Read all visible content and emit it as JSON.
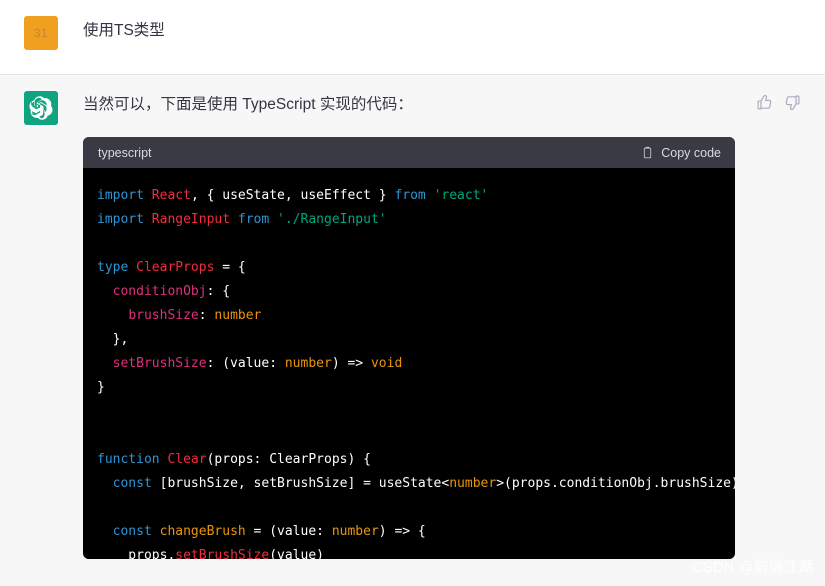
{
  "user_turn": {
    "avatar_label": "31",
    "avatar_color": "#f0a020",
    "message": "使用TS类型"
  },
  "assistant_turn": {
    "avatar_color": "#10a37f",
    "avatar_icon": "openai-logo-icon",
    "message": "当然可以，下面是使用 TypeScript 实现的代码：",
    "feedback": {
      "thumbs_up_icon": "thumbs-up-icon",
      "thumbs_down_icon": "thumbs-down-icon"
    },
    "code_block": {
      "language_label": "typescript",
      "copy_label": "Copy code",
      "copy_icon": "clipboard-icon",
      "header_bg": "#3a3a45",
      "body_bg": "#000000",
      "lines": [
        [
          {
            "t": "import ",
            "c": "t-kw"
          },
          {
            "t": "React",
            "c": "t-cls"
          },
          {
            "t": ", { useState, useEffect } ",
            "c": "t-plain"
          },
          {
            "t": "from ",
            "c": "t-kw"
          },
          {
            "t": "'react'",
            "c": "t-str"
          }
        ],
        [
          {
            "t": "import ",
            "c": "t-kw"
          },
          {
            "t": "RangeInput ",
            "c": "t-cls"
          },
          {
            "t": "from ",
            "c": "t-kw"
          },
          {
            "t": "'./RangeInput'",
            "c": "t-str"
          }
        ],
        [],
        [
          {
            "t": "type ",
            "c": "t-kw"
          },
          {
            "t": "ClearProps ",
            "c": "t-cls"
          },
          {
            "t": "= {",
            "c": "t-plain"
          }
        ],
        [
          {
            "t": "  ",
            "c": "t-plain"
          },
          {
            "t": "conditionObj",
            "c": "t-prop"
          },
          {
            "t": ": {",
            "c": "t-plain"
          }
        ],
        [
          {
            "t": "    ",
            "c": "t-plain"
          },
          {
            "t": "brushSize",
            "c": "t-prop"
          },
          {
            "t": ": ",
            "c": "t-plain"
          },
          {
            "t": "number",
            "c": "t-type"
          }
        ],
        [
          {
            "t": "  },",
            "c": "t-plain"
          }
        ],
        [
          {
            "t": "  ",
            "c": "t-plain"
          },
          {
            "t": "setBrushSize",
            "c": "t-prop"
          },
          {
            "t": ": (value: ",
            "c": "t-plain"
          },
          {
            "t": "number",
            "c": "t-type"
          },
          {
            "t": ") => ",
            "c": "t-plain"
          },
          {
            "t": "void",
            "c": "t-type"
          }
        ],
        [
          {
            "t": "}",
            "c": "t-plain"
          }
        ],
        [],
        [],
        [
          {
            "t": "function ",
            "c": "t-kw"
          },
          {
            "t": "Clear",
            "c": "t-cls"
          },
          {
            "t": "(props: ClearProps) {",
            "c": "t-plain"
          }
        ],
        [
          {
            "t": "  ",
            "c": "t-plain"
          },
          {
            "t": "const ",
            "c": "t-kw"
          },
          {
            "t": "[brushSize, setBrushSize] = useState<",
            "c": "t-plain"
          },
          {
            "t": "number",
            "c": "t-type"
          },
          {
            "t": ">(props.conditionObj.brushSize)",
            "c": "t-plain"
          }
        ],
        [],
        [
          {
            "t": "  ",
            "c": "t-plain"
          },
          {
            "t": "const ",
            "c": "t-kw"
          },
          {
            "t": "changeBrush ",
            "c": "t-fn"
          },
          {
            "t": "= (value: ",
            "c": "t-plain"
          },
          {
            "t": "number",
            "c": "t-type"
          },
          {
            "t": ") => {",
            "c": "t-plain"
          }
        ],
        [
          {
            "t": "    props.",
            "c": "t-plain"
          },
          {
            "t": "setBrushSize",
            "c": "t-cls"
          },
          {
            "t": "(value)",
            "c": "t-plain"
          }
        ],
        [
          {
            "t": "  }",
            "c": "t-plain"
          }
        ]
      ]
    }
  },
  "watermark": "CSDN @前端江湖"
}
